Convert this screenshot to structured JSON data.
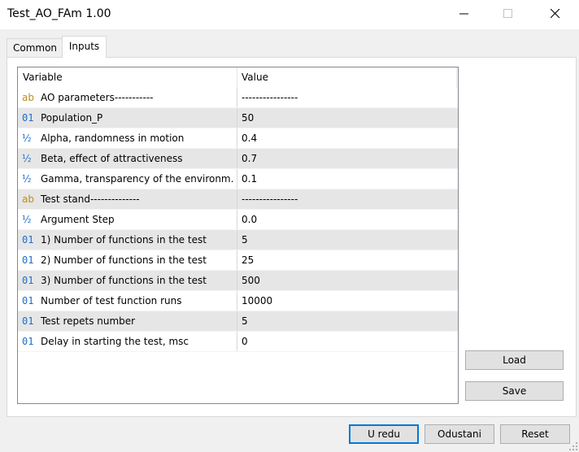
{
  "window": {
    "title": "Test_AO_FAm 1.00"
  },
  "tabs": [
    {
      "label": "Common"
    },
    {
      "label": "Inputs"
    }
  ],
  "grid": {
    "headers": {
      "variable": "Variable",
      "value": "Value"
    },
    "rows": [
      {
        "type": "ab",
        "icon": "ab",
        "variable": "AO parameters-----------",
        "value": "----------------"
      },
      {
        "type": "int",
        "icon": "01",
        "variable": "Population_P",
        "value": "50"
      },
      {
        "type": "double",
        "icon": "½",
        "variable": "Alpha, randomness in motion",
        "value": "0.4"
      },
      {
        "type": "double",
        "icon": "½",
        "variable": "Beta, effect of attractiveness",
        "value": "0.7"
      },
      {
        "type": "double",
        "icon": "½",
        "variable": "Gamma, transparency of the environm...",
        "value": "0.1"
      },
      {
        "type": "ab",
        "icon": "ab",
        "variable": "Test stand--------------",
        "value": "----------------"
      },
      {
        "type": "double",
        "icon": "½",
        "variable": "Argument Step",
        "value": "0.0"
      },
      {
        "type": "int",
        "icon": "01",
        "variable": "1) Number of functions in the test",
        "value": "5"
      },
      {
        "type": "int",
        "icon": "01",
        "variable": "2) Number of functions in the test",
        "value": "25"
      },
      {
        "type": "int",
        "icon": "01",
        "variable": "3) Number of functions in the test",
        "value": "500"
      },
      {
        "type": "int",
        "icon": "01",
        "variable": "Number of test function runs",
        "value": "10000"
      },
      {
        "type": "int",
        "icon": "01",
        "variable": "Test repets number",
        "value": "5"
      },
      {
        "type": "int",
        "icon": "01",
        "variable": "Delay in starting the test, msc",
        "value": "0"
      }
    ]
  },
  "side_buttons": {
    "load": "Load",
    "save": "Save"
  },
  "footer": {
    "ok": "U redu",
    "cancel": "Odustani",
    "reset": "Reset"
  }
}
